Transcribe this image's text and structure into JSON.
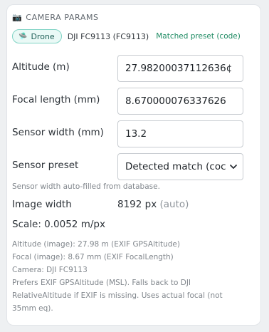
{
  "header": {
    "icon": "camera-icon",
    "title": "CAMERA PARAMS"
  },
  "source": {
    "badge_icon": "drone-icon",
    "badge_label": "Drone",
    "model": "DJI FC9113 (FC9113)",
    "match_status": "Matched preset (code)"
  },
  "fields": {
    "altitude": {
      "label": "Altitude (m)",
      "value": "27.98200037112636¢"
    },
    "focal_length": {
      "label": "Focal length (mm)",
      "value": "8.670000076337626"
    },
    "sensor_width": {
      "label": "Sensor width (mm)",
      "value": "13.2"
    },
    "sensor_preset": {
      "label": "Sensor preset",
      "selected": "Detected match (coc"
    }
  },
  "sensor_hint": "Sensor width auto-filled from database.",
  "image_width": {
    "label": "Image width",
    "value": "8192 px",
    "tag": "(auto)"
  },
  "scale": "Scale: 0.0052 m/px",
  "notes": {
    "altitude": "Altitude (image): 27.98 m (EXIF GPSAltitude)",
    "focal": "Focal (image): 8.67 mm (EXIF FocalLength)",
    "camera": "Camera: DJI FC9113",
    "explanation": "Prefers EXIF GPSAltitude (MSL). Falls back to DJI RelativeAltitude if EXIF is missing. Uses actual focal (not 35mm eq)."
  },
  "colors": {
    "badge_border": "#7fd3c4",
    "badge_bg": "#eaf9f6",
    "match_green": "#1d8a62"
  }
}
